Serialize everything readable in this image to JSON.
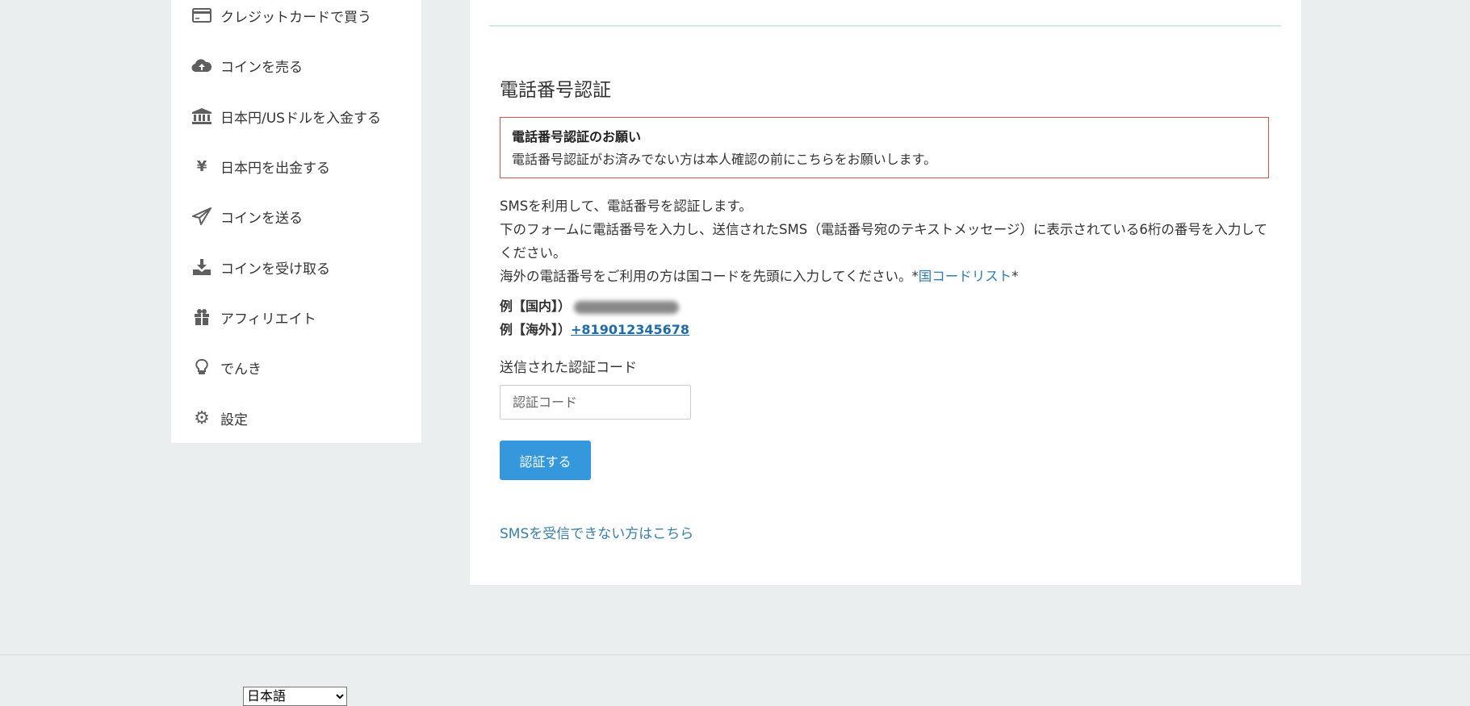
{
  "sidebar": {
    "items": [
      {
        "label": "クレジットカードで買う",
        "icon": "credit-card-icon"
      },
      {
        "label": "コインを売る",
        "icon": "cloud-upload-icon"
      },
      {
        "label": "日本円/USドルを入金する",
        "icon": "bank-icon"
      },
      {
        "label": "日本円を出金する",
        "icon": "yen-icon"
      },
      {
        "label": "コインを送る",
        "icon": "paper-plane-icon"
      },
      {
        "label": "コインを受け取る",
        "icon": "download-icon"
      },
      {
        "label": "アフィリエイト",
        "icon": "gift-icon"
      },
      {
        "label": "でんき",
        "icon": "lightbulb-icon"
      },
      {
        "label": "設定",
        "icon": "gear-icon"
      }
    ]
  },
  "main": {
    "title": "電話番号認証",
    "notice": {
      "title": "電話番号認証のお願い",
      "body": "電話番号認証がお済みでない方は本人確認の前にこちらをお願いします。",
      "border_color": "#c9574f"
    },
    "desc": {
      "line1": "SMSを利用して、電話番号を認証します。",
      "line2": "下のフォームに電話番号を入力し、送信されたSMS（電話番号宛のテキストメッセージ）に表示されている6桁の番号を入力してください。",
      "line3_prefix": "海外の電話番号をご利用の方は国コードを先頭に入力してください。*",
      "country_code_link": "国コードリスト",
      "line3_suffix": "*"
    },
    "example_domestic_label": "例【国内】）",
    "example_overseas_label": "例【海外】）",
    "example_overseas_value": "+819012345678",
    "code_label": "送信された認証コード",
    "code_placeholder": "認証コード",
    "submit_label": "認証する",
    "submit_color": "#3598dc",
    "sms_help_link": "SMSを受信できない方はこちら"
  },
  "footer": {
    "language_selected": "日本語"
  }
}
